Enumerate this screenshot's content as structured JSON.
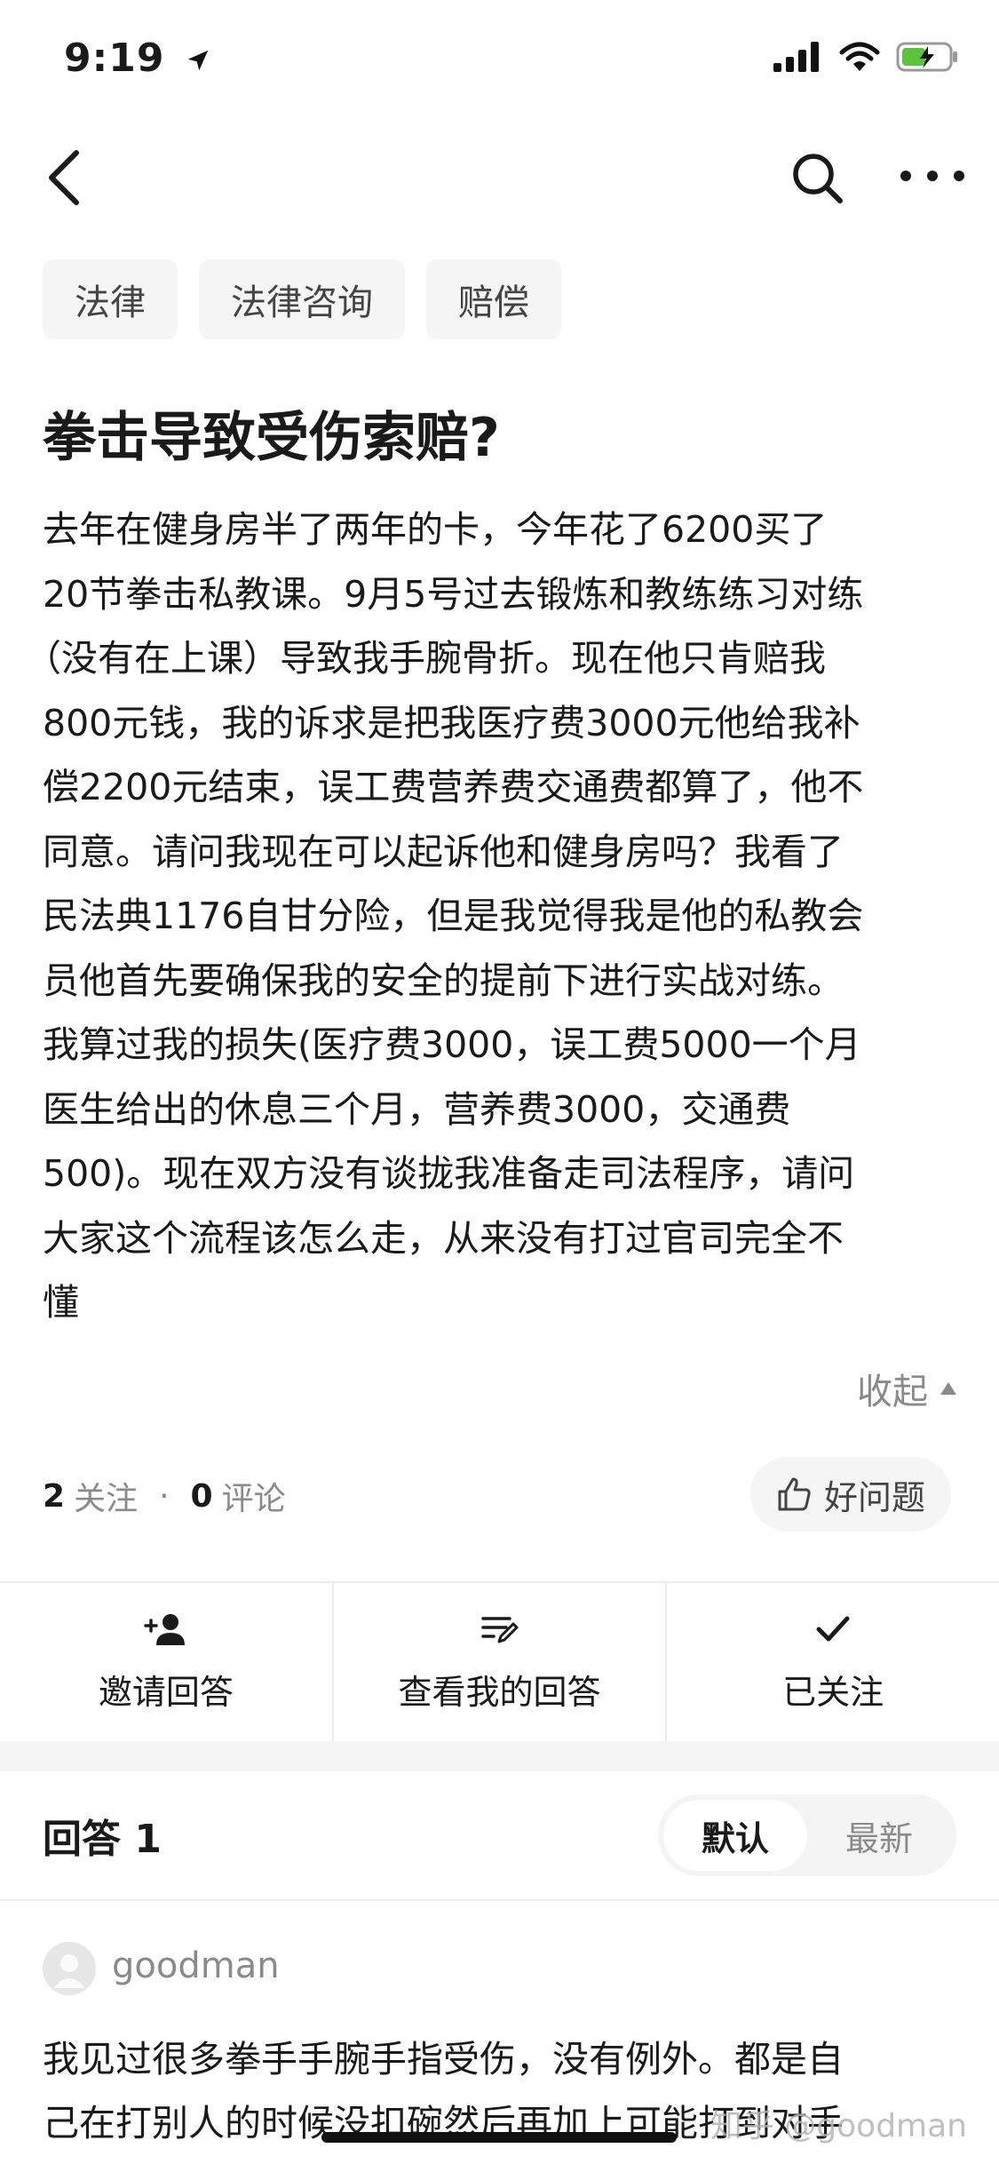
{
  "status": {
    "time": "9:19"
  },
  "nav": {
    "back_icon": "chevron-left-icon",
    "search_icon": "search-icon",
    "more_icon": "more-horizontal-icon"
  },
  "tags": [
    "法律",
    "法律咨询",
    "赔偿"
  ],
  "question": {
    "title": "拳击导致受伤索赔?",
    "lines": [
      "去年在健身房半了两年的卡，今年花了6200买了",
      "20节拳击私教课。9月5号过去锻炼和教练练习对练",
      "（没有在上课）导致我手腕骨折。现在他只肯赔我",
      "800元钱，我的诉求是把我医疗费3000元他给我补",
      "偿2200元结束，误工费营养费交通费都算了，他不",
      "同意。请问我现在可以起诉他和健身房吗？我看了",
      "民法典1176自甘分险，但是我觉得我是他的私教会",
      "员他首先要确保我的安全的提前下进行实战对练。",
      "我算过我的损失(医疗费3000，误工费5000一个月",
      "医生给出的休息三个月，营养费3000，交通费",
      "500)。现在双方没有谈拢我准备走司法程序，请问",
      "大家这个流程该怎么走，从来没有打过官司完全不",
      "懂"
    ],
    "collapse_label": "收起",
    "followers_count": "2",
    "followers_label": "关注",
    "dot": "·",
    "comments_count": "0",
    "comments_label": "评论",
    "good_question_label": "好问题"
  },
  "actions": [
    {
      "label": "邀请回答",
      "icon": "invite-user-icon"
    },
    {
      "label": "查看我的回答",
      "icon": "edit-list-icon"
    },
    {
      "label": "已关注",
      "icon": "check-icon"
    }
  ],
  "answers": {
    "title": "回答 1",
    "sort_options": [
      "默认",
      "最新"
    ],
    "active_sort": "默认",
    "first": {
      "author": "goodman",
      "lines": [
        "我见过很多拳手手腕手指受伤，没有例外。都是自",
        "己在打别人的时候没扣碗然后再加上可能打到对手"
      ]
    }
  },
  "watermark": "知乎 @goodman",
  "colors": {
    "tag_bg": "#f5f5f5",
    "muted_text": "#8a8a8a",
    "battery_green": "#5ac43d"
  }
}
